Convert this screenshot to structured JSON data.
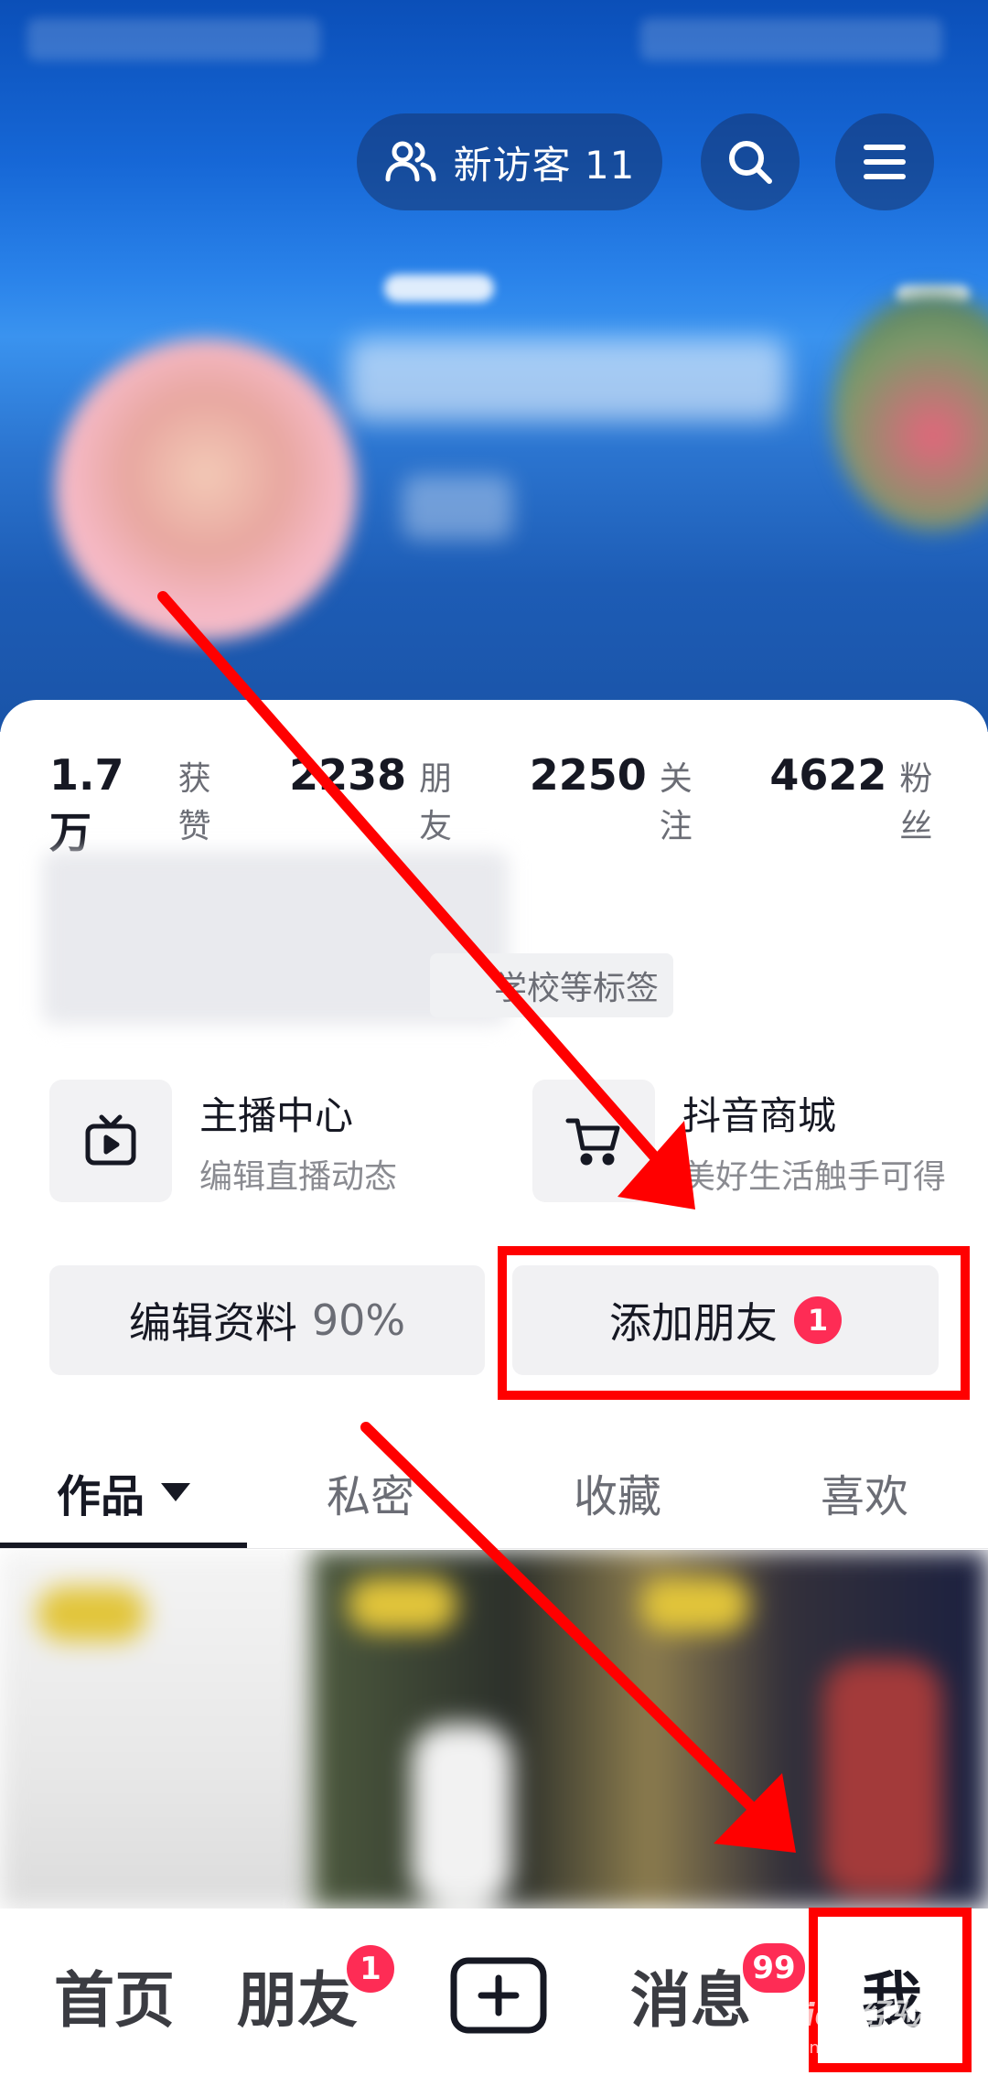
{
  "header": {
    "visitors_label": "新访客 11",
    "icons": {
      "visitors": "people-icon",
      "search": "search-icon",
      "menu": "hamburger-menu-icon"
    }
  },
  "stats": [
    {
      "value": "1.7万",
      "label": "获赞"
    },
    {
      "value": "2238",
      "label": "朋友"
    },
    {
      "value": "2250",
      "label": "关注"
    },
    {
      "value": "4622",
      "label": "粉丝"
    }
  ],
  "profile": {
    "tag_hint": "学校等标签"
  },
  "services": [
    {
      "title": "主播中心",
      "subtitle": "编辑直播动态",
      "icon": "tv-play-icon"
    },
    {
      "title": "抖音商城",
      "subtitle": "美好生活触手可得",
      "icon": "shopping-cart-icon"
    }
  ],
  "actions": {
    "edit_profile": "编辑资料",
    "edit_progress": "90%",
    "add_friend": "添加朋友",
    "add_friend_badge": "1"
  },
  "tabs": [
    {
      "label": "作品",
      "active": true
    },
    {
      "label": "私密",
      "active": false
    },
    {
      "label": "收藏",
      "active": false
    },
    {
      "label": "喜欢",
      "active": false
    }
  ],
  "bottom_nav": {
    "home": "首页",
    "friends": "朋友",
    "friends_badge": "1",
    "create_icon": "plus-square-icon",
    "messages": "消息",
    "messages_badge": "99",
    "me": "我"
  },
  "watermark": {
    "text": "Baidu经验",
    "sub": "jingyan.baidu.com"
  },
  "colors": {
    "accent": "#fe2c55",
    "annotation": "#ff0000",
    "text": "#161823",
    "muted": "#6b6d75"
  }
}
